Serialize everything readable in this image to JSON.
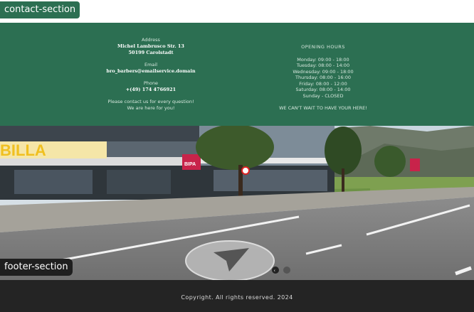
{
  "labels": {
    "contact_section": "contact-section",
    "footer_section": "footer-section"
  },
  "contact": {
    "address_label": "Address",
    "address_line1": "Michel Lambrusco Str. 13",
    "address_line2": "50199 Carolstadt",
    "email_label": "Email",
    "email_value": "bro_barbers@emailservice.domain",
    "phone_label": "Phone",
    "phone_value": "+(49) 174 4766921",
    "message_line1": "Please contact us for every question!",
    "message_line2": "We are here for you!"
  },
  "hours": {
    "title": "OPENING HOURS",
    "days": [
      "Monday: 09:00 - 18:00",
      "Tuesday: 08:00 - 14:00",
      "Wednesday: 09:00 - 18:00",
      "Thursday: 08:00 - 16:00",
      "Friday: 08:00 - 12:00",
      "Saturday: 08:00 - 14:00",
      "Sunday - CLOSED"
    ],
    "tagline": "WE CAN'T WAIT TO HAVE YOUR HERE!"
  },
  "street_view": {
    "store_sign": "BILLA",
    "small_sign": "BIPA"
  },
  "footer": {
    "copyright": "Copyright. All rights reserved. 2024"
  },
  "colors": {
    "contact_bg": "#2c6f52",
    "footer_bg": "#242424"
  }
}
